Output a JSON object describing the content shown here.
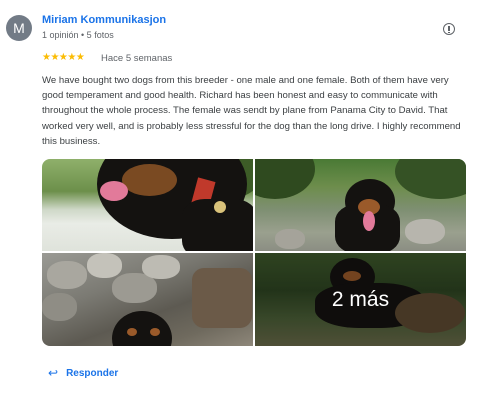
{
  "author": {
    "initial": "M",
    "name": "Miriam Kommunikasjon",
    "meta": "1 opinión • 5 fotos"
  },
  "review": {
    "stars": "★★★★★",
    "rating": 5,
    "time": "Hace 5 semanas",
    "text": "We have bought two dogs from this breeder - one male and one female. Both of them have very good temperament and good health. Richard has been honest and easy to communicate with throughout the whole process. The female was sendt by plane from Panama City to David. That worked very well, and is probably less stressful for the dog than the long drive. I highly recommend this business."
  },
  "photos": {
    "more_label": "2 más"
  },
  "actions": {
    "reply_label": "Responder"
  },
  "colors": {
    "link": "#1a73e8",
    "star": "#fbbc04",
    "avatar": "#727b86"
  },
  "icons": {
    "info": "info-icon",
    "reply": "reply-arrow-icon"
  }
}
